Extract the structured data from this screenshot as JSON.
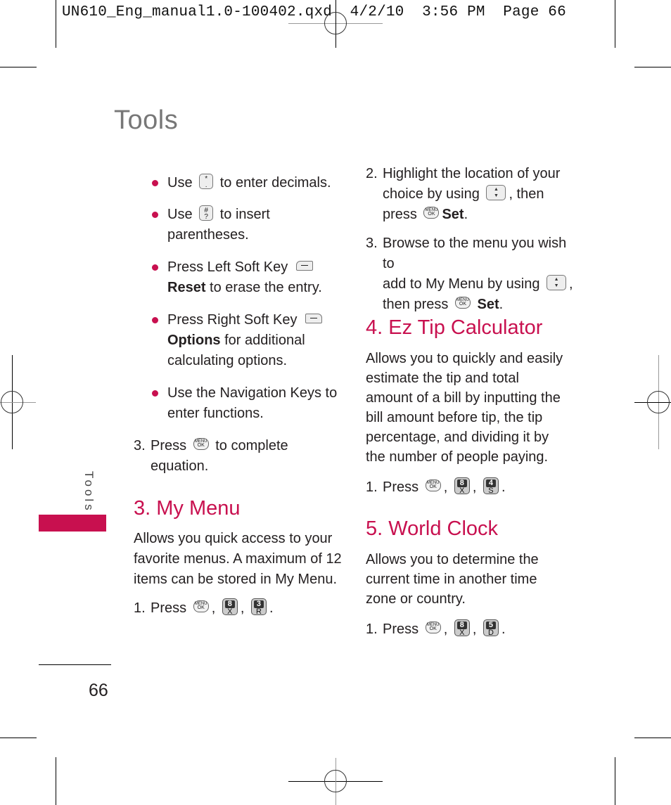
{
  "print_slug": "UN610_Eng_manual1.0-100402.qxd  4/2/10  3:56 PM  Page 66",
  "colors": {
    "accent": "#c8104f",
    "title_gray": "#777777",
    "text": "#231f20"
  },
  "page_title": "Tools",
  "side_tab": {
    "label": "Tools"
  },
  "page_number": "66",
  "left_column": {
    "bullets": [
      {
        "pre": "Use",
        "icon": "star-key-icon",
        "key_top": "*",
        "key_bottom": ".",
        "post": "to enter decimals."
      },
      {
        "pre": "Use",
        "icon": "pound-key-icon",
        "key_top": "#",
        "key_bottom": "?",
        "post": "to insert",
        "post2": "parentheses."
      },
      {
        "pre": "Press Left Soft Key",
        "icon": "left-soft-key-icon",
        "bold": "Reset",
        "post": "to erase the entry."
      },
      {
        "pre": "Press Right Soft Key",
        "icon": "right-soft-key-icon",
        "bold": "Options",
        "post": "for additional",
        "post2": "calculating options."
      },
      {
        "line1": "Use the Navigation Keys to",
        "line2": "enter functions."
      }
    ],
    "step3": {
      "num": "3.",
      "pre": "Press",
      "icon": "menu-ok-key-icon",
      "post": "to complete",
      "post2": "equation."
    },
    "my_menu": {
      "heading": "3. My Menu",
      "lines": [
        "Allows you quick access to your",
        "favorite menus. A maximum of 12",
        "items can be stored in My Menu."
      ],
      "step1": {
        "num": "1.",
        "label": "Press",
        "keys": [
          {
            "top": "8",
            "bottom": "X"
          },
          {
            "top": "3",
            "bottom": "R"
          }
        ]
      }
    }
  },
  "right_column": {
    "step2": {
      "num": "2.",
      "line1": "Highlight the location of your",
      "line2_pre": "choice by using",
      "line2_post": ", then",
      "line3_pre": "press",
      "line3_bold": "Set",
      "line3_post": "."
    },
    "step3": {
      "num": "3.",
      "line1": "Browse to the menu you wish to",
      "line2_pre": "add to My Menu by using",
      "line2_post": ",",
      "line3_pre": "then press",
      "line3_bold": "Set",
      "line3_post": "."
    },
    "ez_tip": {
      "heading": "4. Ez Tip Calculator",
      "lines": [
        "Allows you to quickly and easily",
        "estimate the tip and total",
        "amount of a bill by inputting the",
        "bill amount before tip, the tip",
        "percentage, and dividing it by",
        "the number of people paying."
      ],
      "step1": {
        "num": "1.",
        "label": "Press",
        "keys": [
          {
            "top": "8",
            "bottom": "X"
          },
          {
            "top": "4",
            "bottom": "S"
          }
        ]
      }
    },
    "world_clock": {
      "heading": "5. World Clock",
      "lines": [
        "Allows you to determine the",
        "current time in another time",
        "zone or country."
      ],
      "step1": {
        "num": "1.",
        "label": "Press",
        "keys": [
          {
            "top": "8",
            "bottom": "X"
          },
          {
            "top": "5",
            "bottom": "D"
          }
        ]
      }
    }
  },
  "key_labels": {
    "menu": "MENU",
    "ok": "OK",
    "nav_up": "▲",
    "nav_down": "▼"
  }
}
